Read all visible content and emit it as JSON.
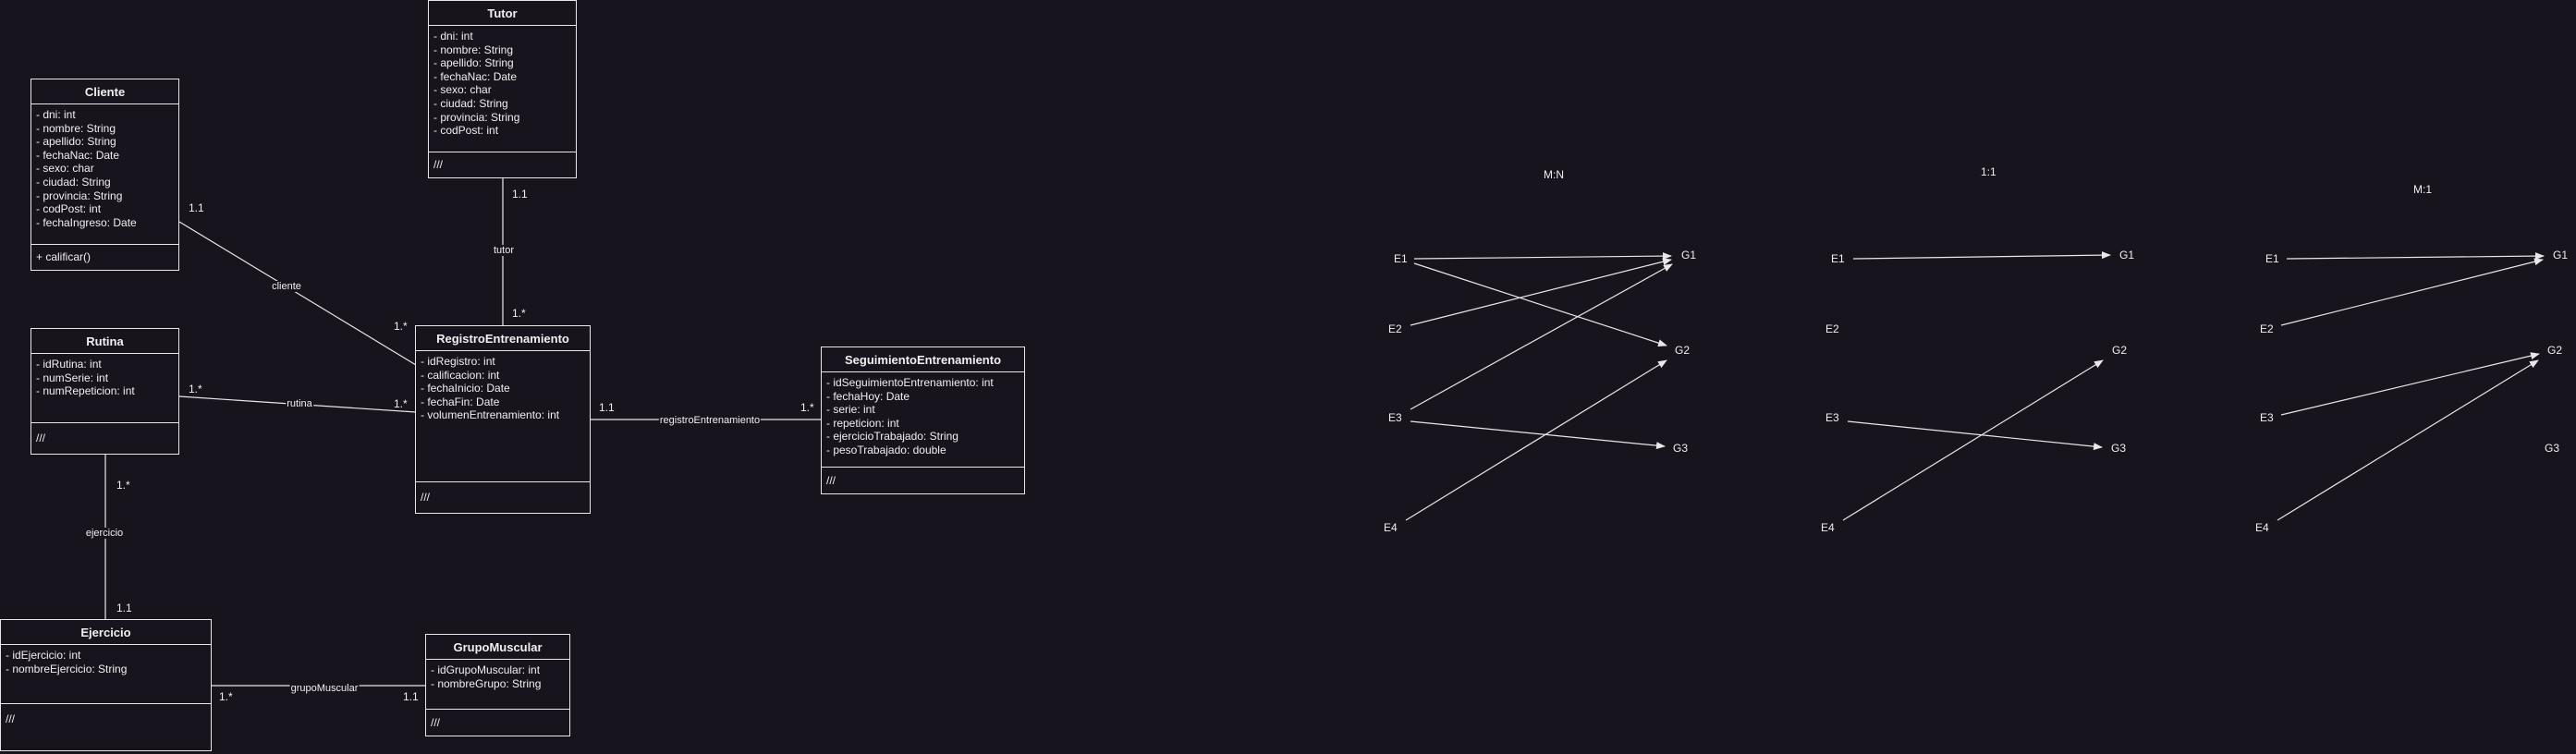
{
  "classes": {
    "tutor": {
      "name": "Tutor",
      "attributes": [
        "- dni: int",
        "- nombre: String",
        "- apellido: String",
        "- fechaNac: Date",
        "- sexo: char",
        "- ciudad: String",
        "- provincia: String",
        "- codPost: int"
      ],
      "operations": "///"
    },
    "cliente": {
      "name": "Cliente",
      "attributes": [
        "- dni: int",
        "- nombre: String",
        "- apellido: String",
        "- fechaNac: Date",
        "- sexo: char",
        "- ciudad: String",
        "- provincia: String",
        "- codPost: int",
        "- fechaIngreso: Date"
      ],
      "operations": "+ calificar()"
    },
    "rutina": {
      "name": "Rutina",
      "attributes": [
        "- idRutina: int",
        "- numSerie: int",
        "- numRepeticion: int"
      ],
      "operations": "///"
    },
    "registro": {
      "name": "RegistroEntrenamiento",
      "attributes": [
        "- idRegistro: int",
        "- calificacion: int",
        "- fechaInicio: Date",
        "- fechaFin: Date",
        "- volumenEntrenamiento: int"
      ],
      "operations": "///"
    },
    "seguimiento": {
      "name": "SeguimientoEntrenamiento",
      "attributes": [
        "- idSeguimientoEntrenamiento: int",
        "- fechaHoy: Date",
        "- serie: int",
        "- repeticion: int",
        "- ejercicioTrabajado: String",
        "- pesoTrabajado: double"
      ],
      "operations": "///"
    },
    "ejercicio": {
      "name": "Ejercicio",
      "attributes": [
        "- idEjercicio: int",
        "- nombreEjercicio: String"
      ],
      "operations": "///"
    },
    "grupo": {
      "name": "GrupoMuscular",
      "attributes": [
        "- idGrupoMuscular: int",
        "- nombreGrupo: String"
      ],
      "operations": "///"
    }
  },
  "associations": {
    "tutor": {
      "name": "tutor",
      "end_a": "1.1",
      "end_b": "1.*"
    },
    "cliente": {
      "name": "cliente",
      "end_a": "1.1",
      "end_b": "1.*"
    },
    "rutina": {
      "name": "rutina",
      "end_a": "1.*",
      "end_b": "1.*"
    },
    "registro": {
      "name": "registroEntrenamiento",
      "end_a": "1.1",
      "end_b": "1.*"
    },
    "ejercicio": {
      "name": "ejercicio",
      "end_a": "1.*",
      "end_b": "1.1"
    },
    "grupo": {
      "name": "grupoMuscular",
      "end_a": "1.*",
      "end_b": "1.1"
    }
  },
  "mappings": [
    {
      "title": "M:N",
      "e": [
        "E1",
        "E2",
        "E3",
        "E4"
      ],
      "g": [
        "G1",
        "G2",
        "G3"
      ]
    },
    {
      "title": "1:1",
      "e": [
        "E1",
        "E2",
        "E3",
        "E4"
      ],
      "g": [
        "G1",
        "G2",
        "G3"
      ]
    },
    {
      "title": "M:1",
      "e": [
        "E1",
        "E2",
        "E3",
        "E4"
      ],
      "g": [
        "G1",
        "G2",
        "G3"
      ]
    }
  ],
  "colors": {
    "background": "#18141d",
    "stroke": "#e8e8e8",
    "text": "#f0f0f0"
  }
}
